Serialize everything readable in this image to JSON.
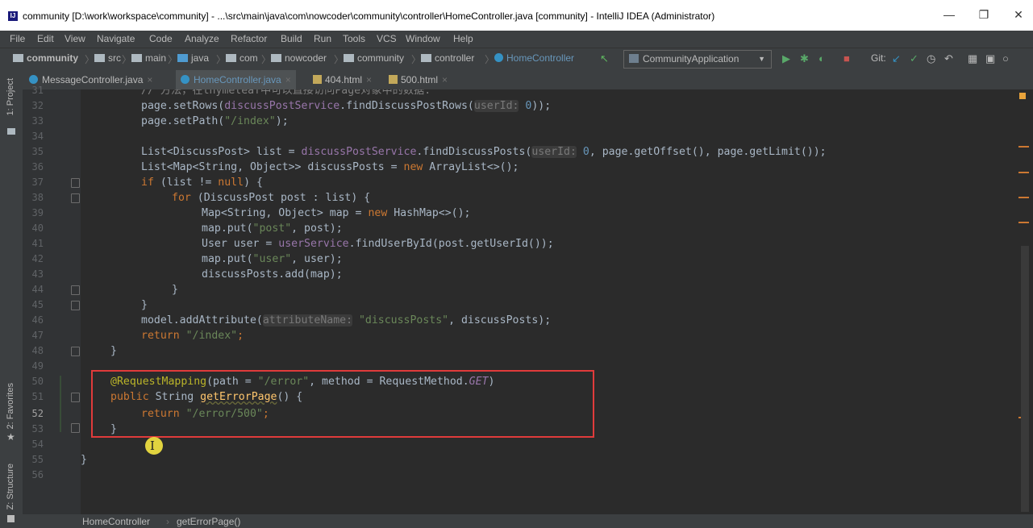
{
  "window": {
    "title": "community [D:\\work\\workspace\\community] - ...\\src\\main\\java\\com\\nowcoder\\community\\controller\\HomeController.java [community] - IntelliJ IDEA (Administrator)",
    "app_icon": "IJ",
    "minimize": "—",
    "restore": "❐",
    "close": "✕"
  },
  "menu": {
    "file": "File",
    "edit": "Edit",
    "view": "View",
    "navigate": "Navigate",
    "code": "Code",
    "analyze": "Analyze",
    "refactor": "Refactor",
    "build": "Build",
    "run": "Run",
    "tools": "Tools",
    "vcs": "VCS",
    "window": "Window",
    "help": "Help"
  },
  "breadcrumbs": [
    "community",
    "src",
    "main",
    "java",
    "com",
    "nowcoder",
    "community",
    "controller",
    "HomeController"
  ],
  "run_config": "CommunityApplication",
  "git_label": "Git:",
  "tabs": [
    {
      "label": "MessageController.java",
      "active": false
    },
    {
      "label": "HomeController.java",
      "active": true
    },
    {
      "label": "404.html",
      "active": false
    },
    {
      "label": "500.html",
      "active": false
    }
  ],
  "tool_windows": {
    "project": "1: Project",
    "favorites": "2: Favorites",
    "structure": "Z: Structure"
  },
  "line_numbers": [
    "31",
    "32",
    "33",
    "34",
    "35",
    "36",
    "37",
    "38",
    "39",
    "40",
    "41",
    "42",
    "43",
    "44",
    "45",
    "46",
    "47",
    "48",
    "49",
    "50",
    "51",
    "52",
    "53",
    "54",
    "55",
    "56"
  ],
  "code": {
    "l31": "// 方法，在thymeleaf中可以直接访问Page对象中的数据.",
    "l32": {
      "a": "page.setRows(",
      "b": "discussPostService",
      "c": ".findDiscussPostRows(",
      "hint": "userId:",
      "d": " 0",
      "e": "));"
    },
    "l33": {
      "a": "page.setPath(",
      "s": "\"/index\"",
      "b": ");"
    },
    "l35": {
      "a": "List<DiscussPost> list = ",
      "b": "discussPostService",
      "c": ".findDiscussPosts(",
      "hint": "userId:",
      "d": " 0",
      "e": ", page.getOffset(), page.getLimit());"
    },
    "l36": {
      "a": "List<Map<String, Object>> discussPosts = ",
      "k": "new",
      "b": " ArrayList<>();"
    },
    "l37": {
      "k": "if",
      "a": " (list != ",
      "k2": "null",
      "b": ") {"
    },
    "l38": {
      "k": "for",
      "a": " (DiscussPost post : list) {"
    },
    "l39": {
      "a": "Map<String, Object> map = ",
      "k": "new",
      "b": " HashMap<>();"
    },
    "l40": {
      "a": "map.put(",
      "s": "\"post\"",
      "b": ", post);"
    },
    "l41": {
      "a": "User user = ",
      "b": "userService",
      "c": ".findUserById(post.getUserId());"
    },
    "l42": {
      "a": "map.put(",
      "s": "\"user\"",
      "b": ", user);"
    },
    "l43": "discussPosts.add(map);",
    "l44": "}",
    "l45": "}",
    "l46": {
      "a": "model.addAttribute(",
      "hint": "attributeName:",
      "s": " \"discussPosts\"",
      "b": ", discussPosts);"
    },
    "l47": {
      "k": "return",
      "s": " \"/index\"",
      "b": ";"
    },
    "l48": "}",
    "l50": {
      "ann": "@RequestMapping",
      "a": "(path = ",
      "s": "\"/error\"",
      "b": ", method = RequestMethod.",
      "it": "GET",
      "c": ")"
    },
    "l51": {
      "k": "public",
      "a": " String ",
      "fn": "getErrorPage",
      "b": "() {"
    },
    "l52": {
      "k": "return",
      "s": " \"/error/500\"",
      "b": ";"
    },
    "l53": "}",
    "l55": "}"
  },
  "status": {
    "crumb1": "HomeController",
    "crumb2": "getErrorPage()"
  },
  "colors": {
    "highlight_box": "#e03b3b",
    "accent_blue": "#3592c4"
  }
}
